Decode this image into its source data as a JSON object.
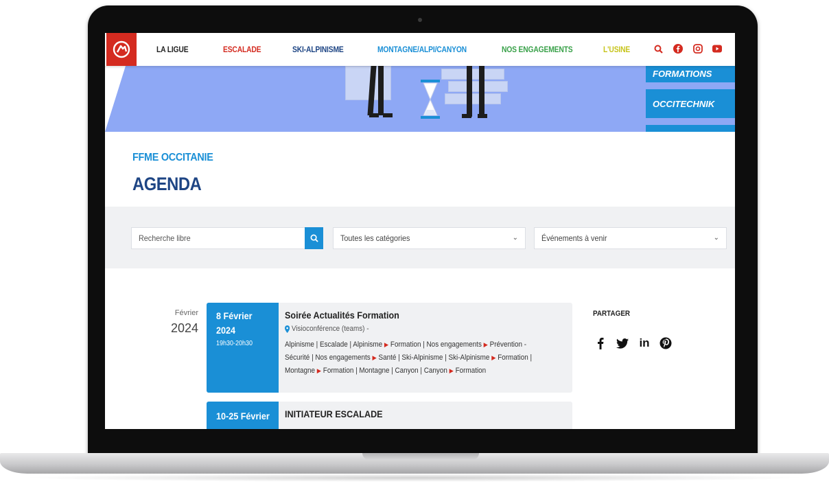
{
  "nav": {
    "items": [
      {
        "label": "LA LIGUE",
        "color": "#222222"
      },
      {
        "label": "ESCALADE",
        "color": "#d42b20"
      },
      {
        "label": "SKI-ALPINISME",
        "color": "#1e4584"
      },
      {
        "label": "MONTAGNE/ALPI/CANYON",
        "color": "#1a8fd6"
      },
      {
        "label": "NOS ENGAGEMENTS",
        "color": "#3aa14a"
      },
      {
        "label": "L'USINE",
        "color": "#c7c41c"
      }
    ],
    "icons": [
      "search-icon",
      "facebook-icon",
      "instagram-icon",
      "youtube-icon"
    ]
  },
  "banner": {
    "side_buttons": [
      "FORMATIONS",
      "OCCITECHNIK"
    ]
  },
  "header": {
    "org_title": "FFME OCCITANIE",
    "page_title": "AGENDA"
  },
  "filters": {
    "search_placeholder": "Recherche libre",
    "category": "Toutes les catégories",
    "period": "Événements à venir"
  },
  "month_group": {
    "month": "Février",
    "year": "2024"
  },
  "events": [
    {
      "date_day": "8 Février",
      "date_year": "2024",
      "time": "19h30-20h30",
      "title": "Soirée Actualités Formation",
      "location": "Visioconférence (teams) -",
      "categories_line1": "Alpinisme | Escalade | Alpinisme",
      "categories_line1b": "Formation | Nos engagements",
      "categories_line1c": "Prévention -",
      "categories_line2": "Sécurité | Nos engagements",
      "categories_line2b": "Santé | Ski-Alpinisme | Ski-Alpinisme",
      "categories_line2c": "Formation |",
      "categories_line3": "Montagne",
      "categories_line3b": "Formation | Montagne | Canyon | Canyon",
      "categories_line3c": "Formation"
    },
    {
      "date_day": "10-25 Février",
      "title": "INITIATEUR ESCALADE"
    }
  ],
  "share": {
    "title": "PARTAGER",
    "icons": [
      "facebook-icon",
      "twitter-icon",
      "linkedin-icon",
      "pinterest-icon"
    ]
  },
  "colors": {
    "brand_blue": "#1a8fd6",
    "navy": "#1e4584",
    "red": "#d42b20",
    "banner": "#8ea8f5"
  }
}
